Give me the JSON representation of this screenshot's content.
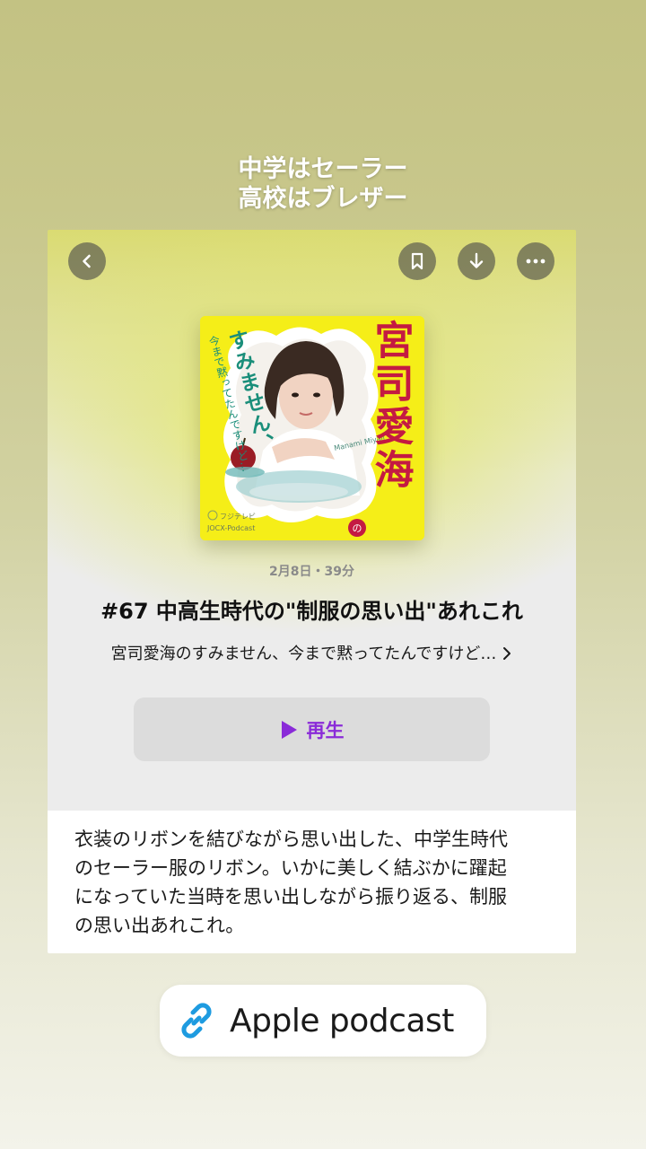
{
  "story": {
    "caption_lines": [
      "中学はセーラー",
      "高校はブレザー"
    ]
  },
  "header": {
    "back_icon": "chevron-left-icon",
    "bookmark_icon": "bookmark-icon",
    "download_icon": "download-icon",
    "more_icon": "ellipsis-icon"
  },
  "artwork": {
    "title_vertical": "宮司愛海",
    "title_no": "の",
    "subtitle_line1": "すみません、",
    "subtitle_line2": "今まで黙ってたんですけど…",
    "name_romaji": "Manami Miyaji",
    "network_logo": "フジテレビ",
    "network_sub": "JOCX-Podcast",
    "bg_color": "#f5ee18"
  },
  "episode": {
    "meta": "2月8日・39分",
    "title": "#67 中高生時代の\"制服の思い出\"あれこれ",
    "show_name": "宮司愛海のすみません、今まで黙ってたんですけど…",
    "play_label": "再生",
    "accent_color": "#8a2bd8"
  },
  "description": {
    "lines": [
      "衣装のリボンを結びながら思い出した、中学生時代",
      "のセーラー服のリボン。いかに美しく結ぶかに躍起",
      "になっていた当時を思い出しながら振り返る、制服",
      "の思い出あれこれ。"
    ]
  },
  "link_sticker": {
    "label": "Apple podcast",
    "icon": "link-icon",
    "icon_color": "#1e9be0"
  }
}
